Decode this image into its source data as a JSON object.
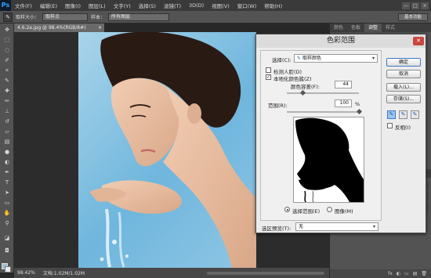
{
  "app": {
    "logo": "Ps"
  },
  "menu": [
    "文件(F)",
    "编辑(E)",
    "图像(I)",
    "图层(L)",
    "文字(Y)",
    "选择(S)",
    "滤镜(T)",
    "3D(D)",
    "视图(V)",
    "窗口(W)",
    "帮助(H)"
  ],
  "window_controls": [
    "—",
    "□",
    "×"
  ],
  "options_bar": {
    "sample_label": "取样大小：",
    "sample_value": "取样点",
    "style_label": "样本：",
    "style_value": "所有图层",
    "workspace": "基本功能"
  },
  "document": {
    "tab_title": "4.6.2a.jpg @ 98.4%(RGB/8#)",
    "close": "×"
  },
  "status": {
    "zoom": "98.42%",
    "doc_info": "文档:1.02M/1.02M"
  },
  "panels": {
    "tabs_top": [
      "颜色",
      "色板",
      "调整",
      "样式"
    ],
    "tabs_bottom": [
      "图层",
      "通道",
      "路径"
    ],
    "active_top": "调整",
    "footer_icons": [
      "fx",
      "◐",
      "▭",
      "▤",
      "🗑"
    ]
  },
  "dialog": {
    "title": "色彩范围",
    "close": "✕",
    "select_label": "选择(C):",
    "select_value": "取样颜色",
    "select_icon": "eyedropper-icon",
    "detect_faces_label": "检测人脸(D)",
    "detect_faces_checked": false,
    "localized_label": "本地化颜色簇(Z)",
    "localized_checked": true,
    "fuzziness_label": "颜色容差(F):",
    "fuzziness_value": "44",
    "fuzziness_fraction": 0.22,
    "range_label": "范围(R):",
    "range_value": "100",
    "range_unit": "%",
    "range_fraction": 1.0,
    "radio_selection": "选择范围(E)",
    "radio_image": "图像(M)",
    "radio_selected": "selection",
    "preview_label": "选区预览(T):",
    "preview_value": "无",
    "buttons": {
      "ok": "确定",
      "cancel": "取消",
      "load": "载入(L)...",
      "save": "存储(S)..."
    },
    "invert_label": "反相(I)",
    "invert_checked": false
  }
}
